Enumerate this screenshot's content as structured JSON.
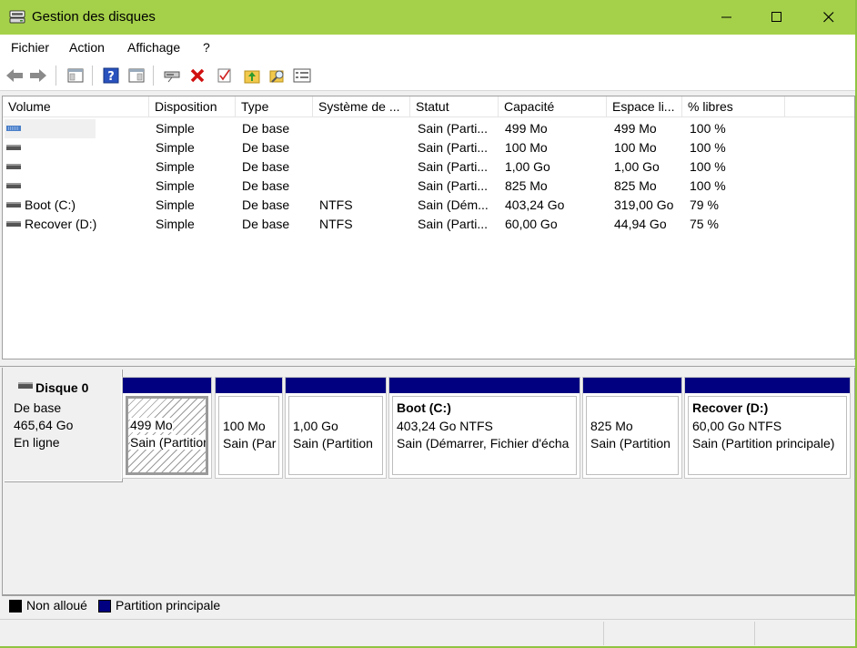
{
  "window": {
    "title": "Gestion des disques"
  },
  "menu": {
    "items": [
      "Fichier",
      "Action",
      "Affichage",
      "?"
    ]
  },
  "toolbar": {
    "buttons": [
      "back-arrow-icon",
      "forward-arrow-icon",
      "console-tree-icon",
      "help-icon",
      "properties-view-icon",
      "connect-drive-icon",
      "delete-icon",
      "check-properties-icon",
      "up-folder-icon",
      "search-icon",
      "list-view-icon"
    ]
  },
  "volume_list": {
    "columns": [
      "Volume",
      "Disposition",
      "Type",
      "Système de ...",
      "Statut",
      "Capacité",
      "Espace li...",
      "% libres"
    ],
    "rows": [
      {
        "volume": "",
        "disposition": "Simple",
        "type": "De base",
        "fs": "",
        "status": "Sain (Parti...",
        "capacity": "499 Mo",
        "free": "499 Mo",
        "pct": "100 %"
      },
      {
        "volume": "",
        "disposition": "Simple",
        "type": "De base",
        "fs": "",
        "status": "Sain (Parti...",
        "capacity": "100 Mo",
        "free": "100 Mo",
        "pct": "100 %"
      },
      {
        "volume": "",
        "disposition": "Simple",
        "type": "De base",
        "fs": "",
        "status": "Sain (Parti...",
        "capacity": "1,00 Go",
        "free": "1,00 Go",
        "pct": "100 %"
      },
      {
        "volume": "",
        "disposition": "Simple",
        "type": "De base",
        "fs": "",
        "status": "Sain (Parti...",
        "capacity": "825 Mo",
        "free": "825 Mo",
        "pct": "100 %"
      },
      {
        "volume": "Boot (C:)",
        "disposition": "Simple",
        "type": "De base",
        "fs": "NTFS",
        "status": "Sain (Dém...",
        "capacity": "403,24 Go",
        "free": "319,00 Go",
        "pct": "79 %"
      },
      {
        "volume": "Recover (D:)",
        "disposition": "Simple",
        "type": "De base",
        "fs": "NTFS",
        "status": "Sain (Parti...",
        "capacity": "60,00 Go",
        "free": "44,94 Go",
        "pct": "75 %"
      }
    ]
  },
  "disk": {
    "title": "Disque 0",
    "kind": "De base",
    "size": "465,64 Go",
    "state": "En ligne"
  },
  "partitions": [
    {
      "name": "",
      "size": "499 Mo",
      "status": "Sain (Partition"
    },
    {
      "name": "",
      "size": "100 Mo",
      "status": "Sain (Par"
    },
    {
      "name": "",
      "size": "1,00 Go",
      "status": "Sain (Partition"
    },
    {
      "name": "Boot  (C:)",
      "size": "403,24 Go NTFS",
      "status": "Sain (Démarrer, Fichier d'écha"
    },
    {
      "name": "",
      "size": "825 Mo",
      "status": "Sain (Partition"
    },
    {
      "name": "Recover  (D:)",
      "size": "60,00 Go NTFS",
      "status": "Sain (Partition principale)"
    }
  ],
  "legend": {
    "unallocated": "Non alloué",
    "primary": "Partition principale"
  },
  "colors": {
    "titlebar": "#a5d14a",
    "partition_bar": "#000080",
    "unallocated": "#000000"
  }
}
